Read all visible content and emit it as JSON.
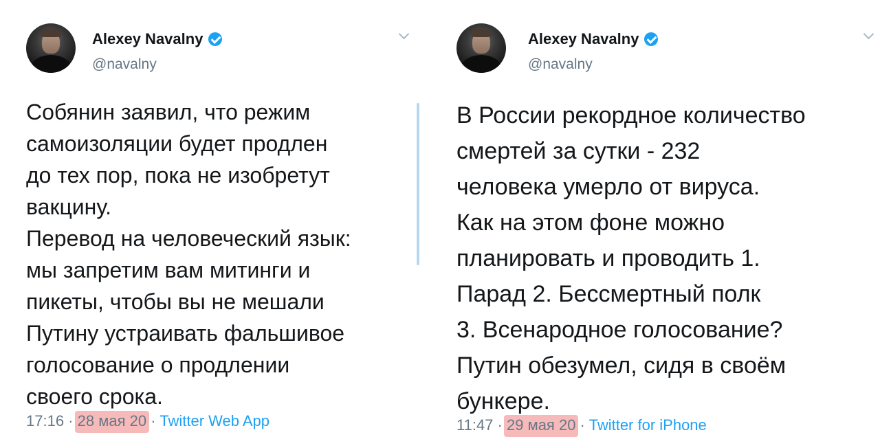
{
  "tweets": [
    {
      "author_name": "Alexey Navalny",
      "handle": "@navalny",
      "text": "Собянин заявил, что режим\nсамоизоляции будет продлен\nдо тех пор, пока не изобретут\nвакцину.\nПеревод на человеческий язык:\nмы запретим вам митинги и\nпикеты, чтобы вы не мешали\nПутину устраивать фальшивое\nголосование о продлении\nсвоего срока.",
      "meta": {
        "time": "17:16",
        "sep1": " · ",
        "date": "28 мая 20",
        "sep2": " · ",
        "client": "Twitter Web App"
      }
    },
    {
      "author_name": "Alexey Navalny",
      "handle": "@navalny",
      "text": "В России рекордное количество\nсмертей за сутки - 232\nчеловека умерло от вируса.\nКак на этом фоне можно\nпланировать и проводить 1.\nПарад 2. Бессмертный полк\n3. Всенародное голосование?\nПутин обезумел, сидя в своём\nбункере.",
      "meta": {
        "time": "11:47",
        "sep1": " · ",
        "date": "29 мая 20",
        "sep2": " · ",
        "client": "Twitter for iPhone"
      }
    }
  ],
  "colors": {
    "verified_badge": "#1da1f2",
    "link": "#1da1f2",
    "secondary_text": "#657786",
    "highlight_marker": "#f08282",
    "divider": "#b6d8ee"
  },
  "icons": {
    "verified": "verified-badge-icon",
    "menu": "chevron-down-icon"
  }
}
